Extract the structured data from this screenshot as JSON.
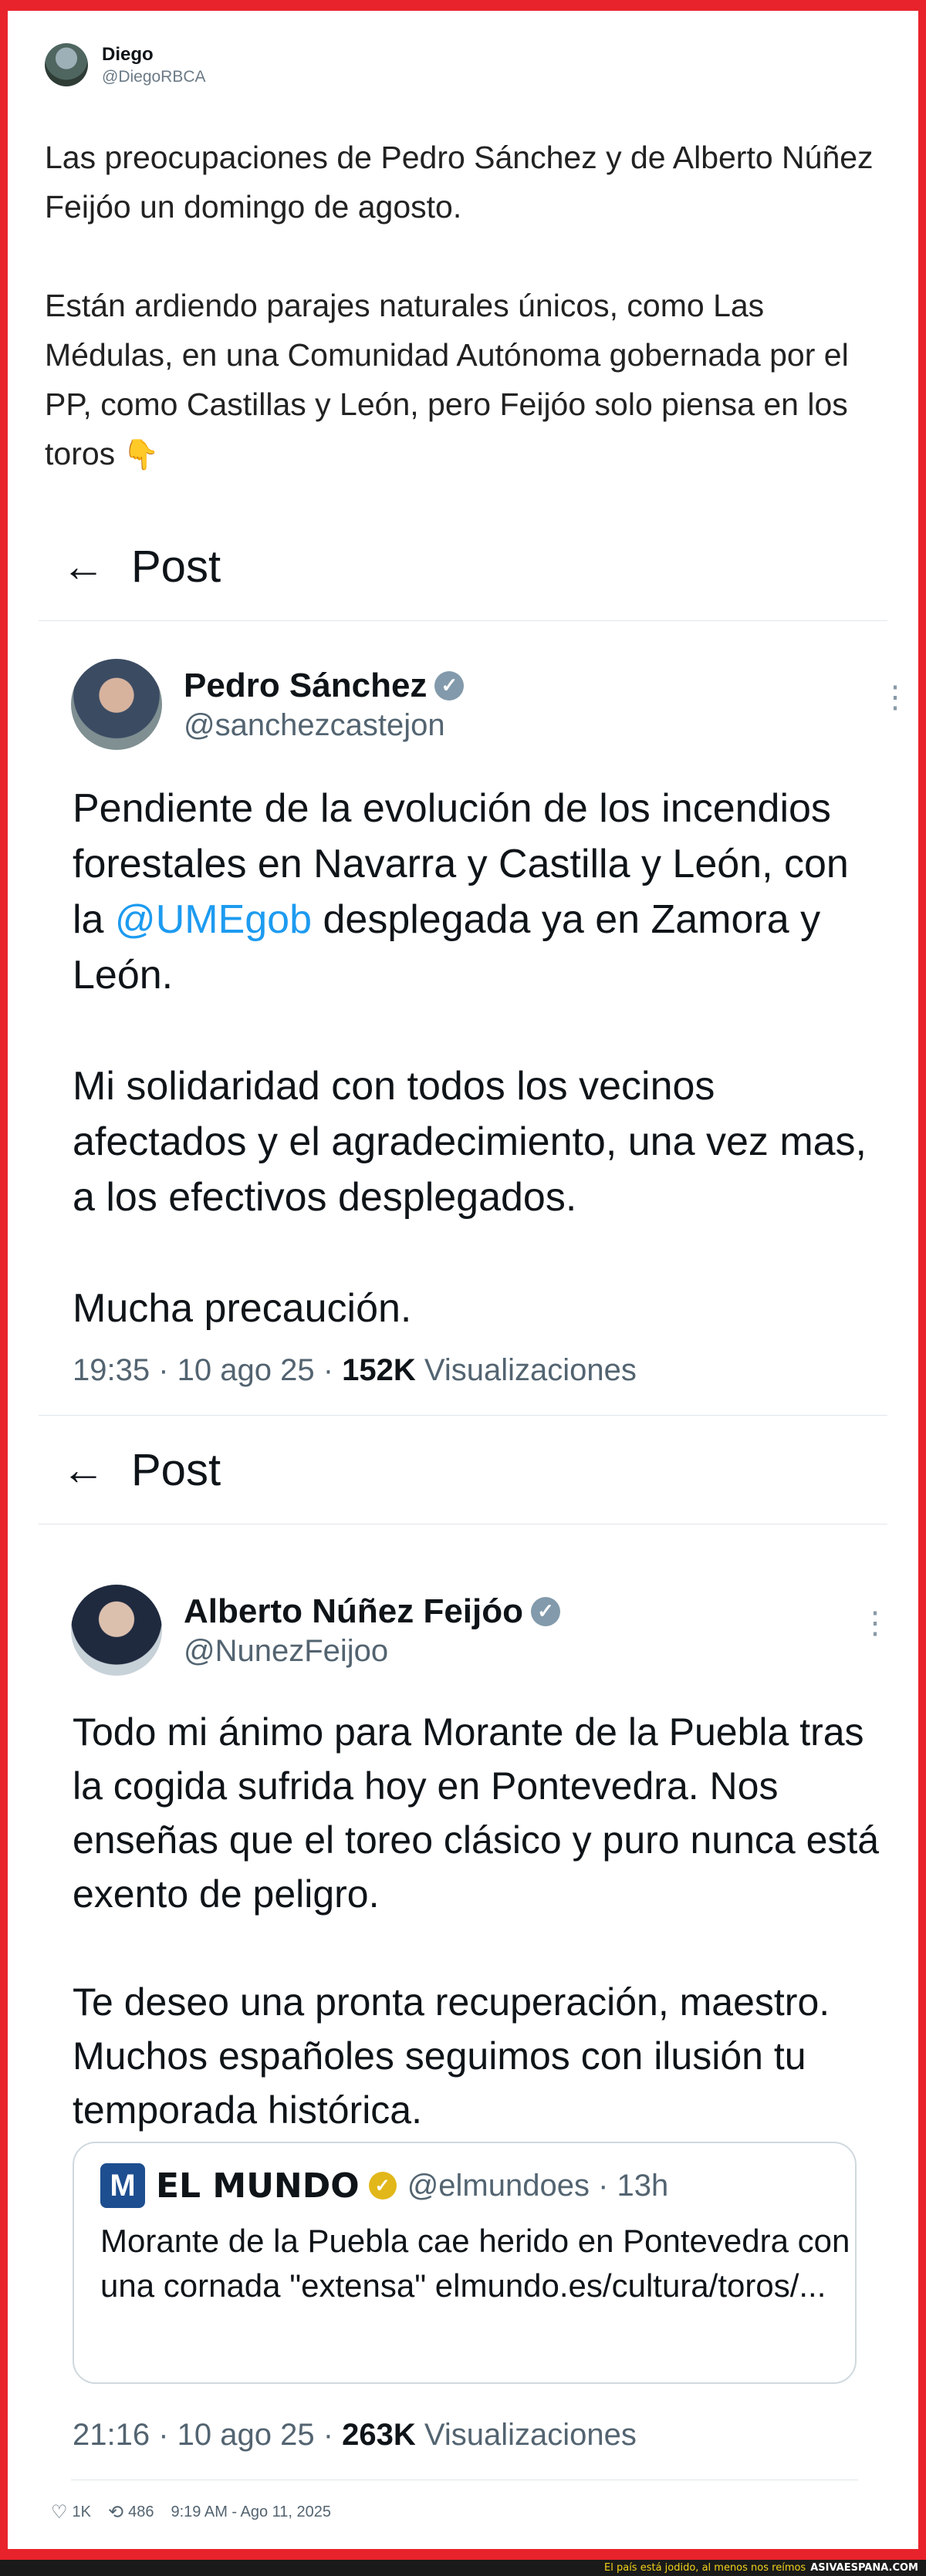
{
  "outer_tweet": {
    "author_name": "Diego",
    "author_handle": "@DiegoRBCA",
    "paragraph_1": "Las preocupaciones de Pedro Sánchez y de Alberto Núñez Feijóo un domingo de agosto.",
    "paragraph_2": "Están ardiendo parajes naturales únicos, como Las Médulas, en una Comunidad Autónoma gobernada por el PP, como Castillas y León, pero Feijóo solo piensa en los toros",
    "emoji": "👇",
    "likes": "1K",
    "retweets": "486",
    "timestamp": "9:19 AM - Ago 11, 2025"
  },
  "screenshot_1": {
    "back_icon": "←",
    "header_title": "Post",
    "author_name": "Pedro Sánchez",
    "author_handle": "@sanchezcastejon",
    "verified_icon": "✓",
    "more_icon": "⋮",
    "text_line_1": "Pendiente de la evolución de los incendios forestales en Navarra y Castilla y León, con la ",
    "mention": "@UMEgob",
    "text_line_1_end": " desplegada ya en Zamora y León.",
    "paragraph_2": "Mi solidaridad con todos los vecinos afectados y el agradecimiento, una vez mas, a los efectivos desplegados.",
    "paragraph_3": "Mucha precaución.",
    "meta_time": "19:35 · 10 ago 25 · ",
    "meta_views": "152K",
    "meta_views_label": " Visualizaciones"
  },
  "screenshot_2": {
    "back_icon": "←",
    "header_title": "Post",
    "author_name": "Alberto Núñez Feijóo",
    "author_handle": "@NunezFeijoo",
    "verified_icon": "✓",
    "more_icon": "⋮",
    "paragraph_1": "Todo mi ánimo para Morante de la Puebla tras la cogida sufrida hoy en Pontevedra. Nos enseñas que el toreo clásico y puro nunca está exento de peligro.",
    "paragraph_2": "Te deseo una pronta recuperación, maestro. Muchos españoles seguimos con ilusión tu temporada histórica.",
    "quote": {
      "logo_letter": "M",
      "name": "EL MUNDO",
      "badge_icon": "✓",
      "handle": "@elmundoes · 13h",
      "text": "Morante de la Puebla cae herido en Pontevedra con una cornada \"extensa\" elmundo.es/cultura/toros/..."
    },
    "meta_time": "21:16 · 10 ago 25 · ",
    "meta_views": "263K",
    "meta_views_label": " Visualizaciones"
  },
  "footer": {
    "caption": "El país está jodido, al menos nos reímos",
    "brand": "ASIVAESPANA.COM"
  }
}
